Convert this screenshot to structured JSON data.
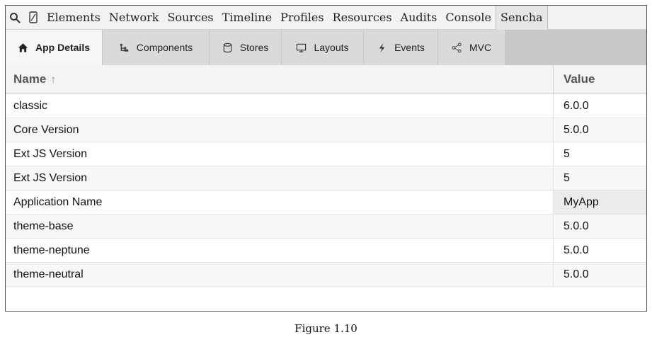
{
  "devtools": {
    "panels": [
      "Elements",
      "Network",
      "Sources",
      "Timeline",
      "Profiles",
      "Resources",
      "Audits",
      "Console"
    ],
    "active_panel": "Sencha"
  },
  "sencha_tabs": [
    {
      "label": "App Details",
      "icon": "home-icon"
    },
    {
      "label": "Components",
      "icon": "tree-icon"
    },
    {
      "label": "Stores",
      "icon": "database-icon"
    },
    {
      "label": "Layouts",
      "icon": "monitor-icon"
    },
    {
      "label": "Events",
      "icon": "lightning-icon"
    },
    {
      "label": "MVC",
      "icon": "share-nodes-icon"
    }
  ],
  "grid": {
    "headers": {
      "name": "Name",
      "sort_indicator": "↑",
      "value": "Value"
    },
    "rows": [
      {
        "name": "classic",
        "value": "6.0.0"
      },
      {
        "name": "Core Version",
        "value": "5.0.0"
      },
      {
        "name": "Ext JS Version",
        "value": "5"
      },
      {
        "name": "Ext JS Version",
        "value": "5"
      },
      {
        "name": "Application Name",
        "value": "MyApp"
      },
      {
        "name": "theme-base",
        "value": "5.0.0"
      },
      {
        "name": "theme-neptune",
        "value": "5.0.0"
      },
      {
        "name": "theme-neutral",
        "value": "5.0.0"
      }
    ]
  },
  "caption": "Figure 1.10"
}
